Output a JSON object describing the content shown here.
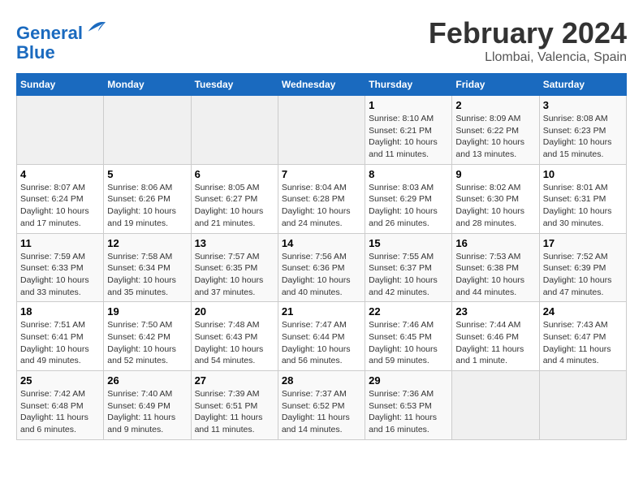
{
  "logo": {
    "line1": "General",
    "line2": "Blue"
  },
  "title": "February 2024",
  "subtitle": "Llombai, Valencia, Spain",
  "weekdays": [
    "Sunday",
    "Monday",
    "Tuesday",
    "Wednesday",
    "Thursday",
    "Friday",
    "Saturday"
  ],
  "weeks": [
    [
      {
        "day": "",
        "info": ""
      },
      {
        "day": "",
        "info": ""
      },
      {
        "day": "",
        "info": ""
      },
      {
        "day": "",
        "info": ""
      },
      {
        "day": "1",
        "info": "Sunrise: 8:10 AM\nSunset: 6:21 PM\nDaylight: 10 hours and 11 minutes."
      },
      {
        "day": "2",
        "info": "Sunrise: 8:09 AM\nSunset: 6:22 PM\nDaylight: 10 hours and 13 minutes."
      },
      {
        "day": "3",
        "info": "Sunrise: 8:08 AM\nSunset: 6:23 PM\nDaylight: 10 hours and 15 minutes."
      }
    ],
    [
      {
        "day": "4",
        "info": "Sunrise: 8:07 AM\nSunset: 6:24 PM\nDaylight: 10 hours and 17 minutes."
      },
      {
        "day": "5",
        "info": "Sunrise: 8:06 AM\nSunset: 6:26 PM\nDaylight: 10 hours and 19 minutes."
      },
      {
        "day": "6",
        "info": "Sunrise: 8:05 AM\nSunset: 6:27 PM\nDaylight: 10 hours and 21 minutes."
      },
      {
        "day": "7",
        "info": "Sunrise: 8:04 AM\nSunset: 6:28 PM\nDaylight: 10 hours and 24 minutes."
      },
      {
        "day": "8",
        "info": "Sunrise: 8:03 AM\nSunset: 6:29 PM\nDaylight: 10 hours and 26 minutes."
      },
      {
        "day": "9",
        "info": "Sunrise: 8:02 AM\nSunset: 6:30 PM\nDaylight: 10 hours and 28 minutes."
      },
      {
        "day": "10",
        "info": "Sunrise: 8:01 AM\nSunset: 6:31 PM\nDaylight: 10 hours and 30 minutes."
      }
    ],
    [
      {
        "day": "11",
        "info": "Sunrise: 7:59 AM\nSunset: 6:33 PM\nDaylight: 10 hours and 33 minutes."
      },
      {
        "day": "12",
        "info": "Sunrise: 7:58 AM\nSunset: 6:34 PM\nDaylight: 10 hours and 35 minutes."
      },
      {
        "day": "13",
        "info": "Sunrise: 7:57 AM\nSunset: 6:35 PM\nDaylight: 10 hours and 37 minutes."
      },
      {
        "day": "14",
        "info": "Sunrise: 7:56 AM\nSunset: 6:36 PM\nDaylight: 10 hours and 40 minutes."
      },
      {
        "day": "15",
        "info": "Sunrise: 7:55 AM\nSunset: 6:37 PM\nDaylight: 10 hours and 42 minutes."
      },
      {
        "day": "16",
        "info": "Sunrise: 7:53 AM\nSunset: 6:38 PM\nDaylight: 10 hours and 44 minutes."
      },
      {
        "day": "17",
        "info": "Sunrise: 7:52 AM\nSunset: 6:39 PM\nDaylight: 10 hours and 47 minutes."
      }
    ],
    [
      {
        "day": "18",
        "info": "Sunrise: 7:51 AM\nSunset: 6:41 PM\nDaylight: 10 hours and 49 minutes."
      },
      {
        "day": "19",
        "info": "Sunrise: 7:50 AM\nSunset: 6:42 PM\nDaylight: 10 hours and 52 minutes."
      },
      {
        "day": "20",
        "info": "Sunrise: 7:48 AM\nSunset: 6:43 PM\nDaylight: 10 hours and 54 minutes."
      },
      {
        "day": "21",
        "info": "Sunrise: 7:47 AM\nSunset: 6:44 PM\nDaylight: 10 hours and 56 minutes."
      },
      {
        "day": "22",
        "info": "Sunrise: 7:46 AM\nSunset: 6:45 PM\nDaylight: 10 hours and 59 minutes."
      },
      {
        "day": "23",
        "info": "Sunrise: 7:44 AM\nSunset: 6:46 PM\nDaylight: 11 hours and 1 minute."
      },
      {
        "day": "24",
        "info": "Sunrise: 7:43 AM\nSunset: 6:47 PM\nDaylight: 11 hours and 4 minutes."
      }
    ],
    [
      {
        "day": "25",
        "info": "Sunrise: 7:42 AM\nSunset: 6:48 PM\nDaylight: 11 hours and 6 minutes."
      },
      {
        "day": "26",
        "info": "Sunrise: 7:40 AM\nSunset: 6:49 PM\nDaylight: 11 hours and 9 minutes."
      },
      {
        "day": "27",
        "info": "Sunrise: 7:39 AM\nSunset: 6:51 PM\nDaylight: 11 hours and 11 minutes."
      },
      {
        "day": "28",
        "info": "Sunrise: 7:37 AM\nSunset: 6:52 PM\nDaylight: 11 hours and 14 minutes."
      },
      {
        "day": "29",
        "info": "Sunrise: 7:36 AM\nSunset: 6:53 PM\nDaylight: 11 hours and 16 minutes."
      },
      {
        "day": "",
        "info": ""
      },
      {
        "day": "",
        "info": ""
      }
    ]
  ]
}
